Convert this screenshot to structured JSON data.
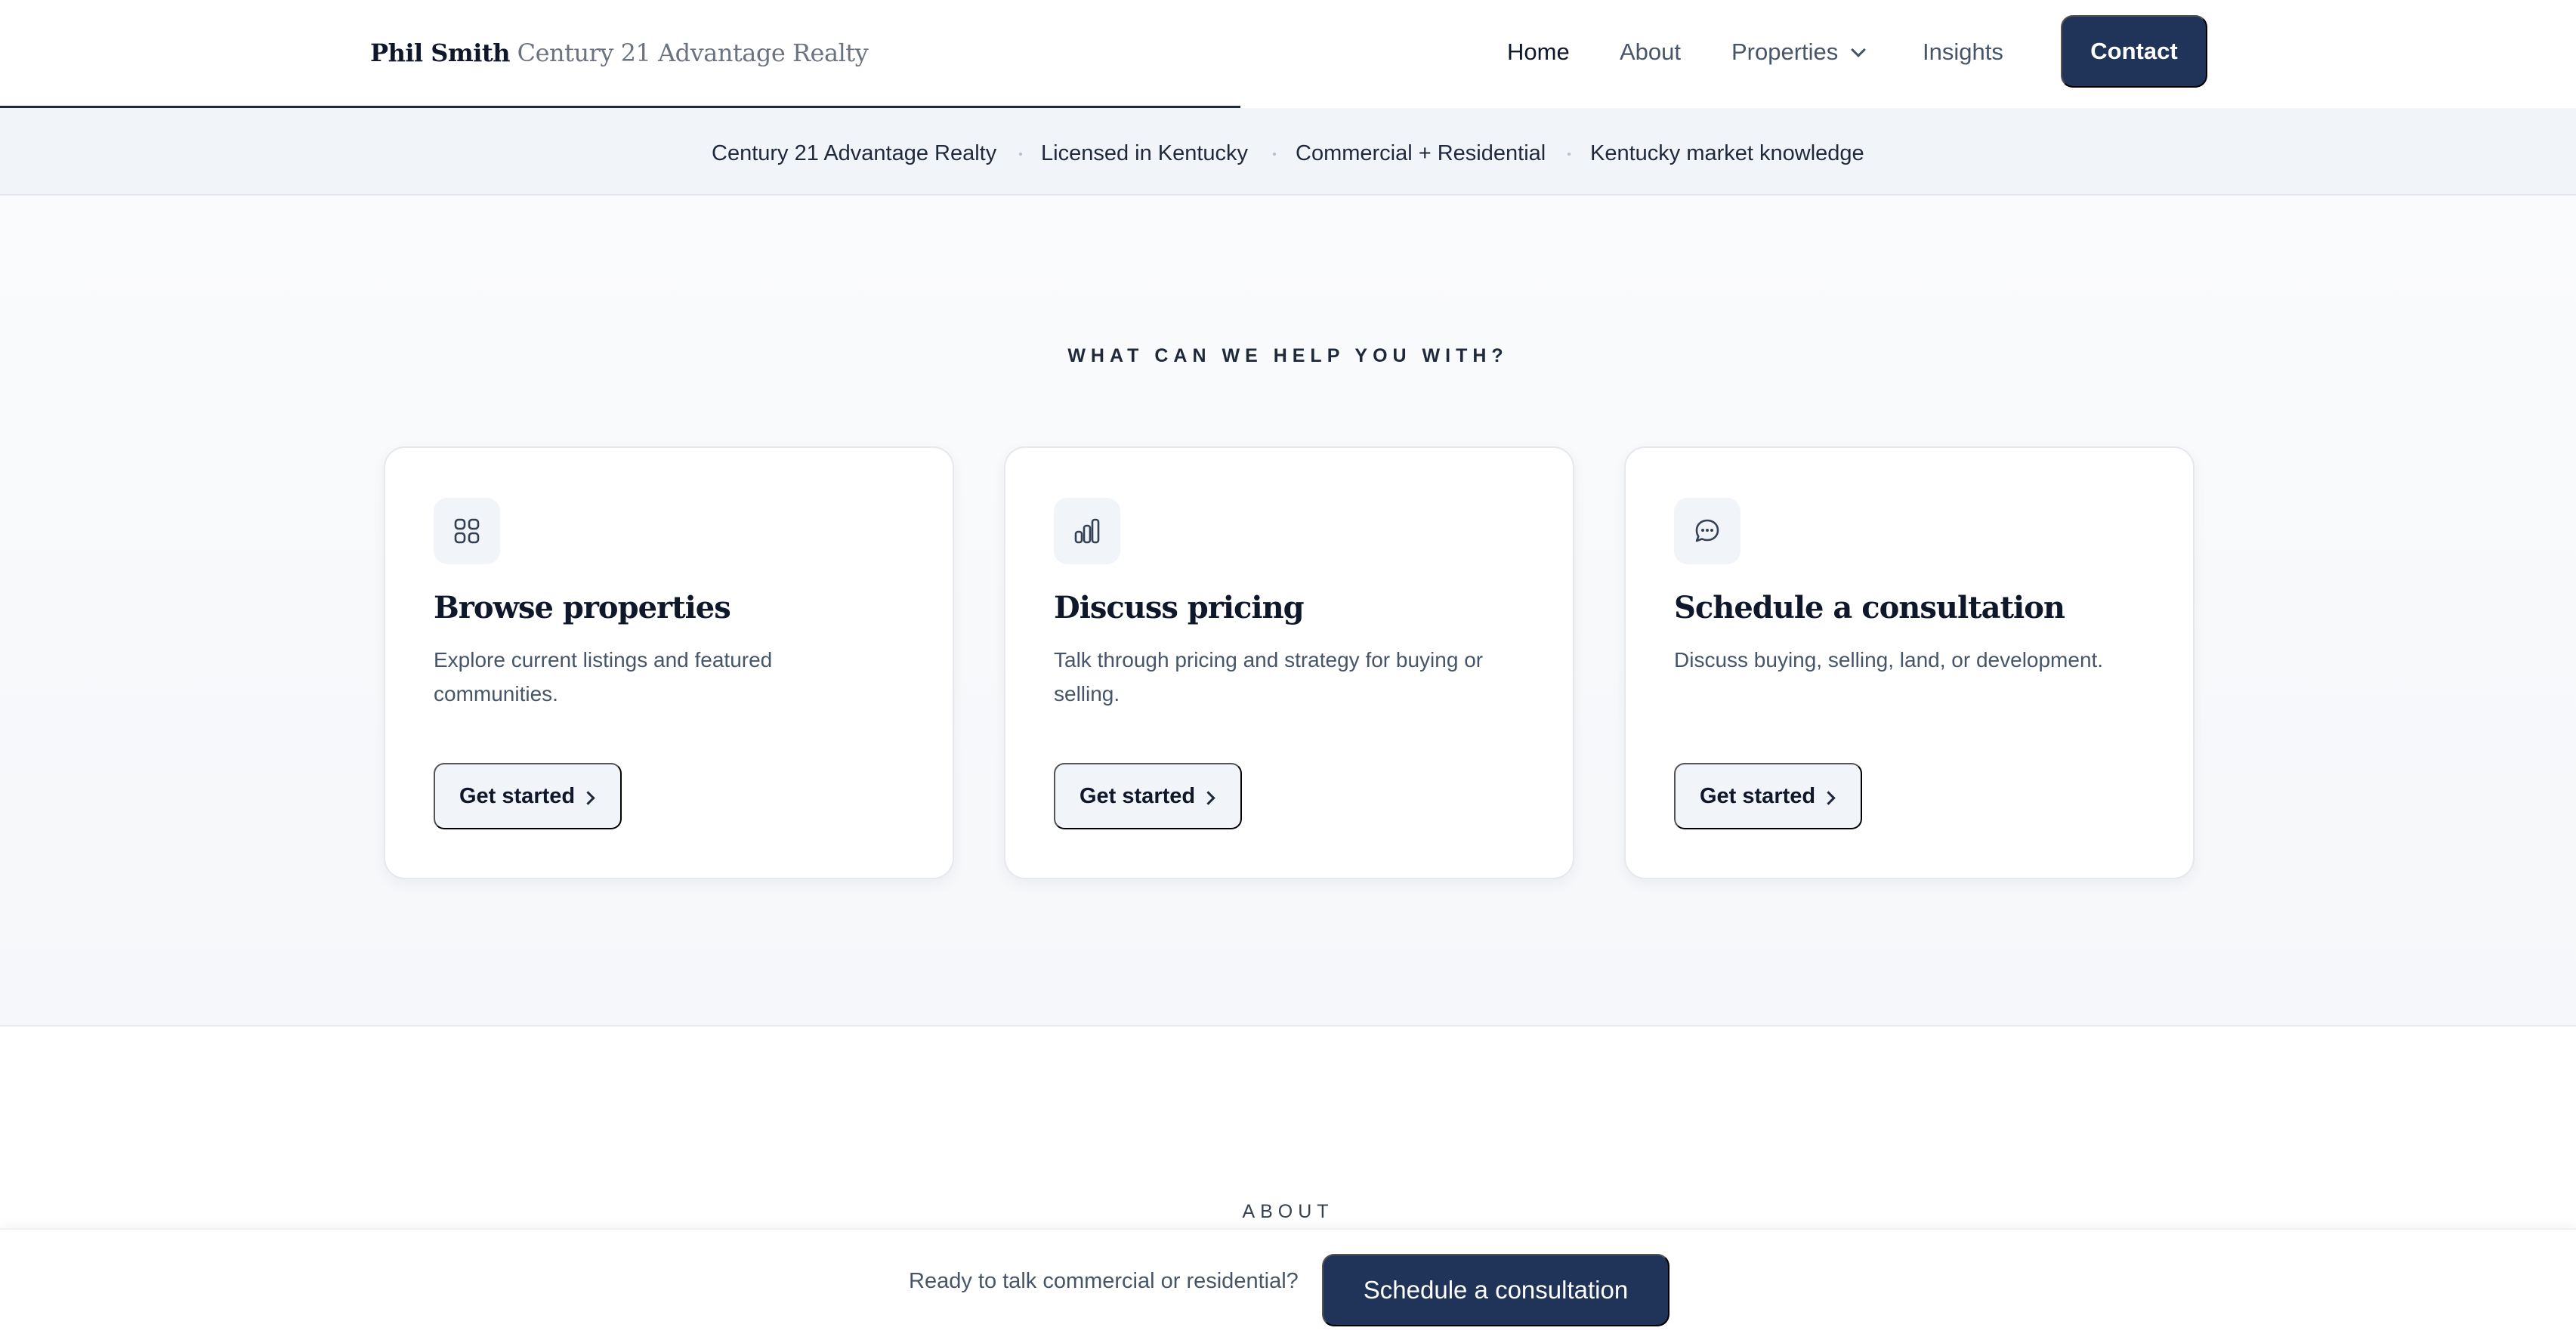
{
  "header": {
    "brand_name": "Phil Smith",
    "brand_company_a": "Century",
    "brand_company_b": "21",
    "brand_company_c": "Advantage Realty",
    "nav": [
      {
        "label": "Home",
        "active": true
      },
      {
        "label": "About",
        "active": false
      },
      {
        "label": "Properties",
        "active": false
      },
      {
        "label": "Insights",
        "active": false
      }
    ],
    "contact_label": "Contact"
  },
  "trust_strip": [
    "Century 21 Advantage Realty",
    "Licensed in Kentucky",
    "Commercial + Residential",
    "Kentucky market knowledge"
  ],
  "help": {
    "eyebrow": "WHAT CAN WE HELP YOU WITH?",
    "cards": [
      {
        "icon": "grid-icon",
        "title": "Browse properties",
        "description": "Explore current listings and featured communities.",
        "button": "Get started"
      },
      {
        "icon": "bar-chart-icon",
        "title": "Discuss pricing",
        "description": "Talk through pricing and strategy for buying or selling.",
        "button": "Get started"
      },
      {
        "icon": "chat-bubble-icon",
        "title": "Schedule a consultation",
        "description": "Discuss buying, selling, land, or development.",
        "button": "Get started"
      }
    ]
  },
  "about": {
    "eyebrow": "ABOUT"
  },
  "cta_bar": {
    "text": "Ready to talk commercial or residential?",
    "button": "Schedule a consultation"
  },
  "colors": {
    "primary": "#1f3458",
    "strip_bg": "#f1f4f8",
    "text_dark": "#0f172a",
    "text_muted": "#475569"
  }
}
